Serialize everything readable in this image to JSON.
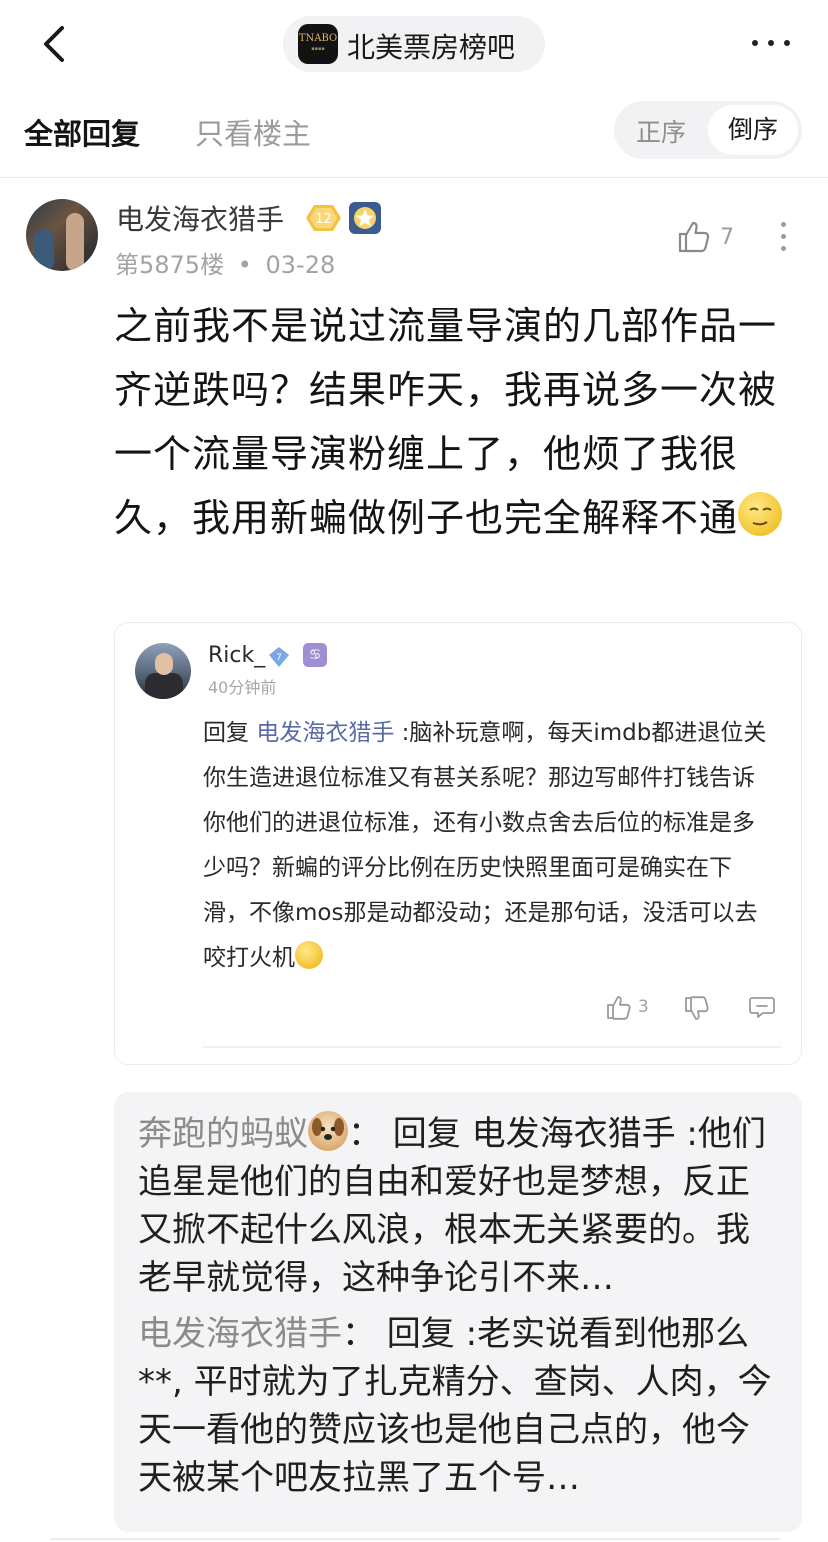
{
  "header": {
    "back_icon": "chevron-left-icon",
    "forum": {
      "logo_text": "TNABO",
      "name": "北美票房榜吧"
    },
    "more_icon": "more-horizontal-icon"
  },
  "tabs": {
    "all_replies": "全部回复",
    "owner_only": "只看楼主",
    "order_asc": "正序",
    "order_desc": "倒序",
    "active_order": "倒序"
  },
  "post": {
    "username": "电发海衣猎手",
    "level": "12",
    "floor": "第5875楼",
    "separator": "•",
    "date": "03-28",
    "like_count": "7",
    "body": "之前我不是说过流量导演的几部作品一齐逆跌吗？结果咋天，我再说多一次被一个流量导演粉缠上了，他烦了我很久，我用新蝙做例子也完全解释不通",
    "body_emoji": "thinking-emoji"
  },
  "reply": {
    "username": "Rick_",
    "vip_level": "7",
    "zodiac": "♋",
    "time": "40分钟前",
    "prefix": "回复 ",
    "mention": "电发海衣猎手",
    "text": " :脑补玩意啊，每天imdb都进退位关你生造进退位标准又有甚关系呢？那边写邮件打钱告诉你他们的进退位标准，还有小数点舍去后位的标准是多少吗？新蝙的评分比例在历史快照里面可是确实在下滑，不像mos那是动都没动；还是那句话，没活可以去咬打火机",
    "like_count": "3"
  },
  "sub_comments": [
    {
      "author": "奔跑的蚂蚁",
      "author_emoji": "dog-emoji",
      "text": "： 回复 电发海衣猎手 :他们追星是他们的自由和爱好也是梦想，反正又掀不起什么风浪，根本无关紧要的。我老早就觉得，这种争论引不来…"
    },
    {
      "author": "电发海衣猎手",
      "text": "： 回复  :老实说看到他那么**, 平时就为了扎克精分、查岗、人肉，今天一看他的赞应该也是他自己点的，他今天被某个吧友拉黑了五个号…"
    }
  ],
  "colors": {
    "mention": "#5a6aa7",
    "muted": "#9b9b9b",
    "sub_bg": "#f4f4f6"
  }
}
